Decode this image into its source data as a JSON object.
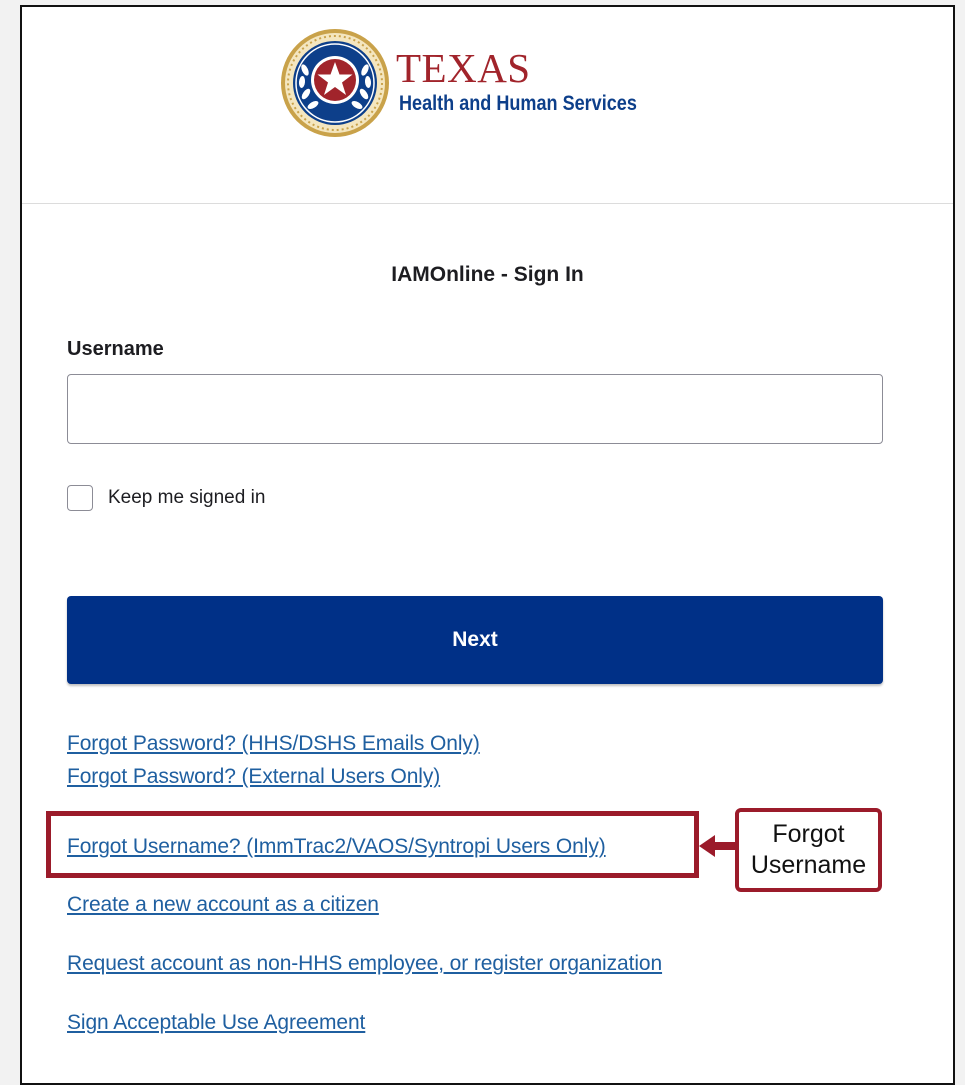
{
  "header": {
    "logo_text_line1": "TEXAS",
    "logo_text_line2": "Health and Human Services",
    "brand_colors": {
      "red": "#a1242b",
      "blue": "#0d3f8a",
      "gold": "#c9a24a"
    }
  },
  "signin": {
    "title": "IAMOnline - Sign In",
    "username_label": "Username",
    "username_value": "",
    "keep_signed_in_label": "Keep me signed in",
    "keep_signed_in_checked": false,
    "next_button_label": "Next",
    "button_color": "#003087"
  },
  "links": {
    "forgot_password_hhs": "Forgot Password? (HHS/DSHS Emails Only)",
    "forgot_password_external": "Forgot Password? (External Users Only)",
    "forgot_username": "Forgot Username? (ImmTrac2/VAOS/Syntropi Users Only)",
    "create_account": "Create a new account as a citizen",
    "request_account": "Request account as non-HHS employee, or register organization",
    "sign_agreement": "Sign Acceptable Use Agreement"
  },
  "annotation": {
    "callout_line1": "Forgot",
    "callout_line2": "Username",
    "highlight_color": "#9b1b2a"
  }
}
